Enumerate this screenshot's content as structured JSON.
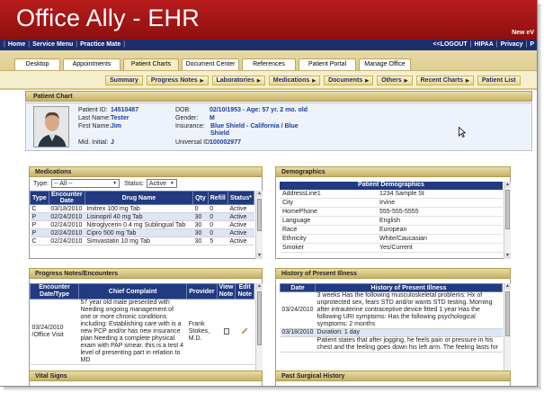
{
  "header": {
    "title": "Office Ally - EHR",
    "note": "New eV"
  },
  "nav": {
    "left": [
      "Home",
      "Service Menu",
      "Practice Mate"
    ],
    "right": [
      "<<LOGOUT",
      "HIPAA",
      "Privacy",
      "P"
    ]
  },
  "tabs": [
    "Desktop",
    "Appointments",
    "Patient Charts",
    "Document Center",
    "References",
    "Patient Portal",
    "Manage Office"
  ],
  "active_tab": "Patient Charts",
  "subnav": [
    "Summary",
    "Progress Notes",
    "Laboratories",
    "Medications",
    "Documents",
    "Others",
    "Recent Charts",
    "Patient List"
  ],
  "patient_chart": {
    "title": "Patient Chart",
    "patient_id_label": "Patient ID:",
    "patient_id": "14510487",
    "last_name_label": "Last Name:",
    "last_name": "Tester",
    "first_name_label": "First Name:",
    "first_name": "Jim",
    "mid_initial_label": "Mid. Initial:",
    "mid_initial": "J",
    "dob_label": "DOB:",
    "dob": "02/10/1953 - Age: 57 yr. 2 mo. old",
    "gender_label": "Gender:",
    "gender": "M",
    "insurance_label": "Insurance:",
    "insurance": "Blue Shield - California / Blue Shield",
    "universal_id_label": "Universal ID:",
    "universal_id": "100002977"
  },
  "medications": {
    "title": "Medications",
    "type_label": "Type:",
    "type_value": "-- All --",
    "status_label": "Status:",
    "status_value": "Active",
    "columns": [
      "Type",
      "Encounter Date",
      "Drug Name",
      "Qty",
      "Refill",
      "Status*"
    ],
    "rows": [
      [
        "C",
        "03/18/2010",
        "Imitrex 100 mg Tab",
        "0",
        "0",
        "Active"
      ],
      [
        "P",
        "02/24/2010",
        "Lisinopril 40 mg Tab",
        "30",
        "0",
        "Active"
      ],
      [
        "P",
        "02/24/2010",
        "Nitroglycerin 0.4 mg Sublingual Tab",
        "30",
        "0",
        "Active"
      ],
      [
        "P",
        "02/24/2010",
        "Cipro 500 mg Tab",
        "30",
        "0",
        "Active"
      ],
      [
        "C",
        "02/24/2010",
        "Simvastatin 10 mg Tab",
        "30",
        "5",
        "Active"
      ]
    ]
  },
  "demographics": {
    "title": "Demographics",
    "table_title": "Patient Demographics",
    "rows": [
      [
        "AddressLine1",
        "1234 Sample St"
      ],
      [
        "City",
        "Irvine"
      ],
      [
        "HomePhone",
        "555-555-5555"
      ],
      [
        "Language",
        "English"
      ],
      [
        "Race",
        "European"
      ],
      [
        "Ethnicity",
        "White/Caucasian"
      ],
      [
        "Smoker",
        "Yes/Current"
      ]
    ]
  },
  "progress_notes": {
    "title": "Progress Notes/Encounters",
    "columns": [
      "Encounter Date/Type",
      "Chief Complaint",
      "Provider",
      "View Note",
      "Edit Note"
    ],
    "row": {
      "date_type": "03/24/2010 /Office Visit",
      "complaint": "57 year old male presented with Needing ongoing management of one or more chronic conditions including: Establishing care with is a new PCP and/or has new insurance plan Needing a complete physical exam with PAP smear. this is a test 4 level of presenting part in relation to MD",
      "provider": "Frank Stokes, M.D."
    }
  },
  "hpi": {
    "title": "History of Present Illness",
    "columns": [
      "Date",
      "History of Present Illness"
    ],
    "rows": [
      [
        "03/24/2010",
        "3 weeks Has the following musculoskeletal problems: Hx of unprotected sex, fears STD and/or wants STD testing. Morning after intrauterine contraceptive device fitted 1 year Has the following URI symptoms: Has the following psychological symptoms: 2 months"
      ],
      [
        "03/18/2010",
        "Duration: 1 day"
      ],
      [
        "",
        "Patient states that after jogging, he feels pain or pressure in his chest and the feeling goes down his left arm. The feeling lasts for"
      ]
    ]
  },
  "vital_signs": {
    "title": "Vital Signs"
  },
  "past_surgical": {
    "title": "Past Surgical History"
  },
  "colors": {
    "brand_red": "#a3161a",
    "nav_blue": "#1d2d6c",
    "table_header": "#213a80",
    "gold": "#d6c47f"
  }
}
